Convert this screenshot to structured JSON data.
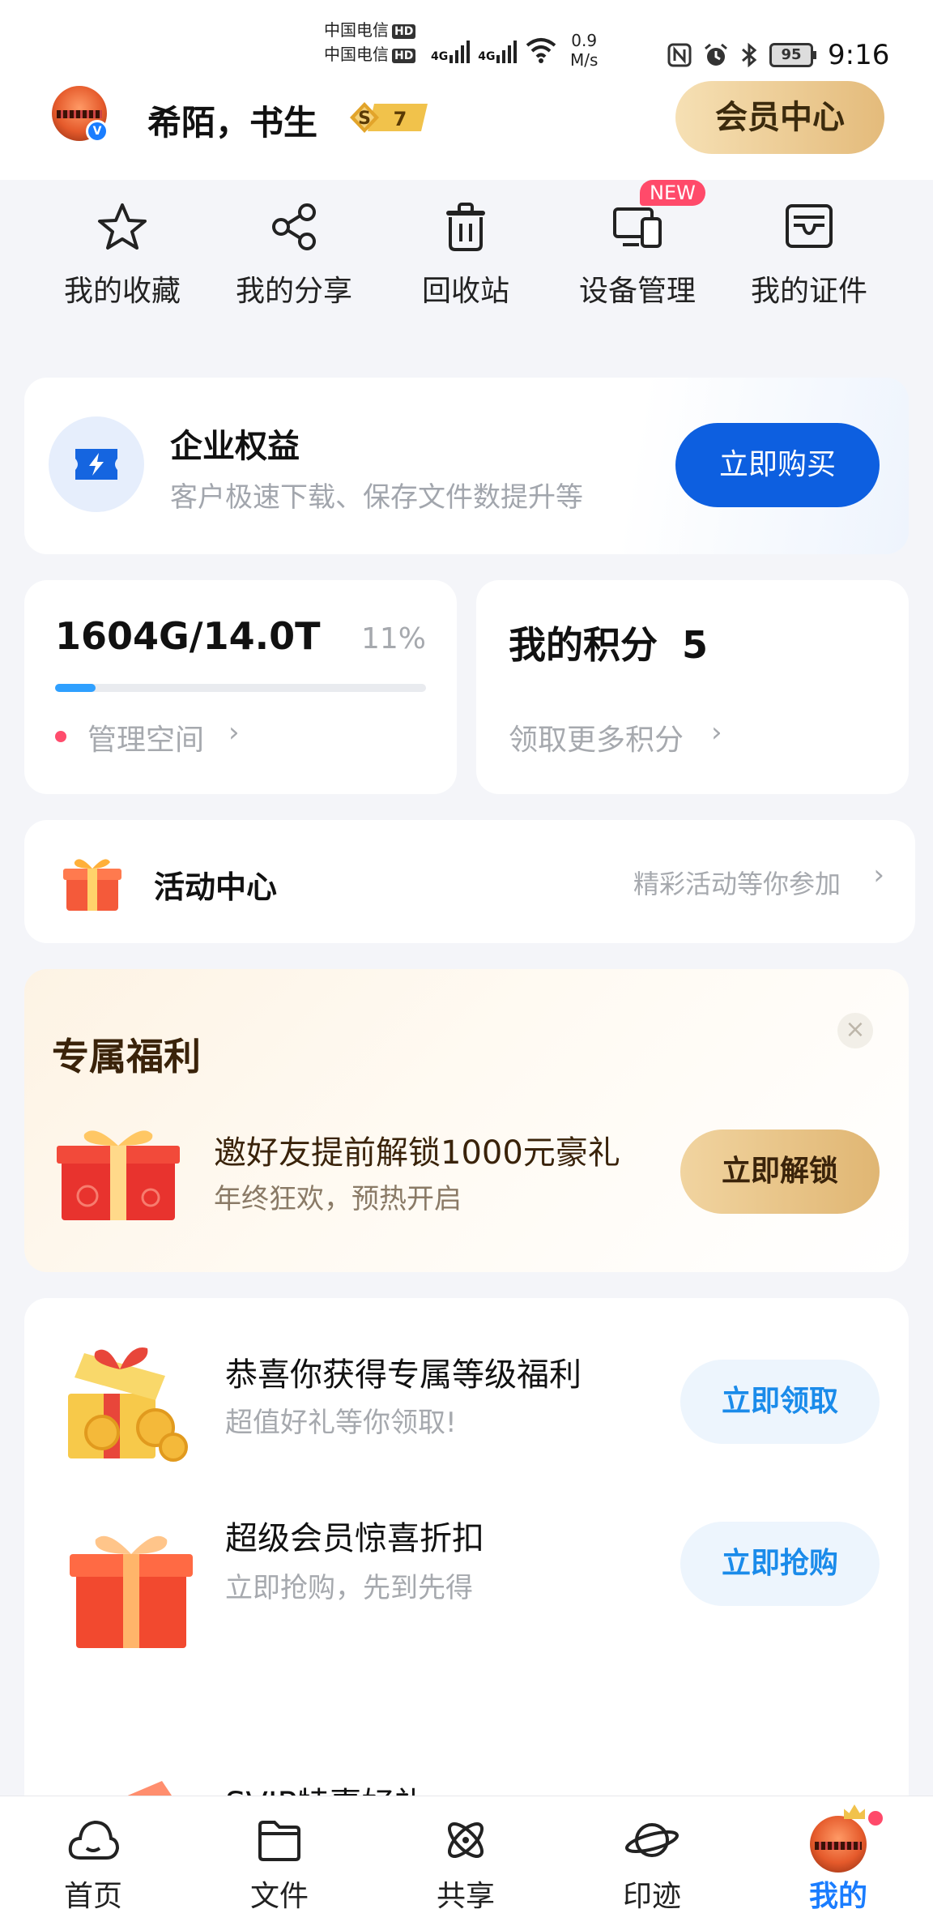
{
  "status_bar": {
    "carrier1": "中国电信",
    "carrier2": "中国电信",
    "hd": "HD",
    "net1": "4G",
    "net2": "4G",
    "speed_value": "0.9",
    "speed_unit": "M/s",
    "battery": "95",
    "time": "9:16"
  },
  "header": {
    "username": "希陌，书生",
    "level_letter": "S",
    "level_num": "7",
    "vip_button": "会员中心",
    "verified_badge": "V"
  },
  "quick_actions": [
    {
      "label": "我的收藏",
      "icon": "star-icon"
    },
    {
      "label": "我的分享",
      "icon": "share-icon"
    },
    {
      "label": "回收站",
      "icon": "trash-icon"
    },
    {
      "label": "设备管理",
      "icon": "devices-icon",
      "tag": "NEW"
    },
    {
      "label": "我的证件",
      "icon": "id-card-icon"
    }
  ],
  "enterprise": {
    "title": "企业权益",
    "subtitle": "客户极速下载、保存文件数提升等",
    "button": "立即购买"
  },
  "storage": {
    "usage": "1604G/14.0T",
    "percent": "11%",
    "percent_value": 0.11,
    "manage": "管理空间"
  },
  "points": {
    "label": "我的积分",
    "value": "5",
    "more": "领取更多积分"
  },
  "activity": {
    "title": "活动中心",
    "hint": "精彩活动等你参加"
  },
  "exclusive": {
    "title": "专属福利",
    "main": "邀好友提前解锁1000元豪礼",
    "sub": "年终狂欢，预热开启",
    "button": "立即解锁",
    "close": "×"
  },
  "benefits": [
    {
      "title": "恭喜你获得专属等级福利",
      "sub": "超值好礼等你领取!",
      "button": "立即领取"
    },
    {
      "title": "超级会员惊喜折扣",
      "sub": "立即抢购，先到先得",
      "button": "立即抢购"
    },
    {
      "title": "SVIP特惠好礼"
    }
  ],
  "bottom_nav": [
    {
      "label": "首页",
      "icon": "cloud-icon"
    },
    {
      "label": "文件",
      "icon": "folder-icon"
    },
    {
      "label": "共享",
      "icon": "atom-icon"
    },
    {
      "label": "印迹",
      "icon": "planet-icon"
    },
    {
      "label": "我的",
      "icon": "avatar-icon",
      "active": true
    }
  ],
  "colors": {
    "primary_blue": "#0d5fe0",
    "active_tab": "#1a7dff",
    "gold": "#e4bb7b",
    "badge_red": "#ff4a6a",
    "progress": "#2fa0ff"
  }
}
